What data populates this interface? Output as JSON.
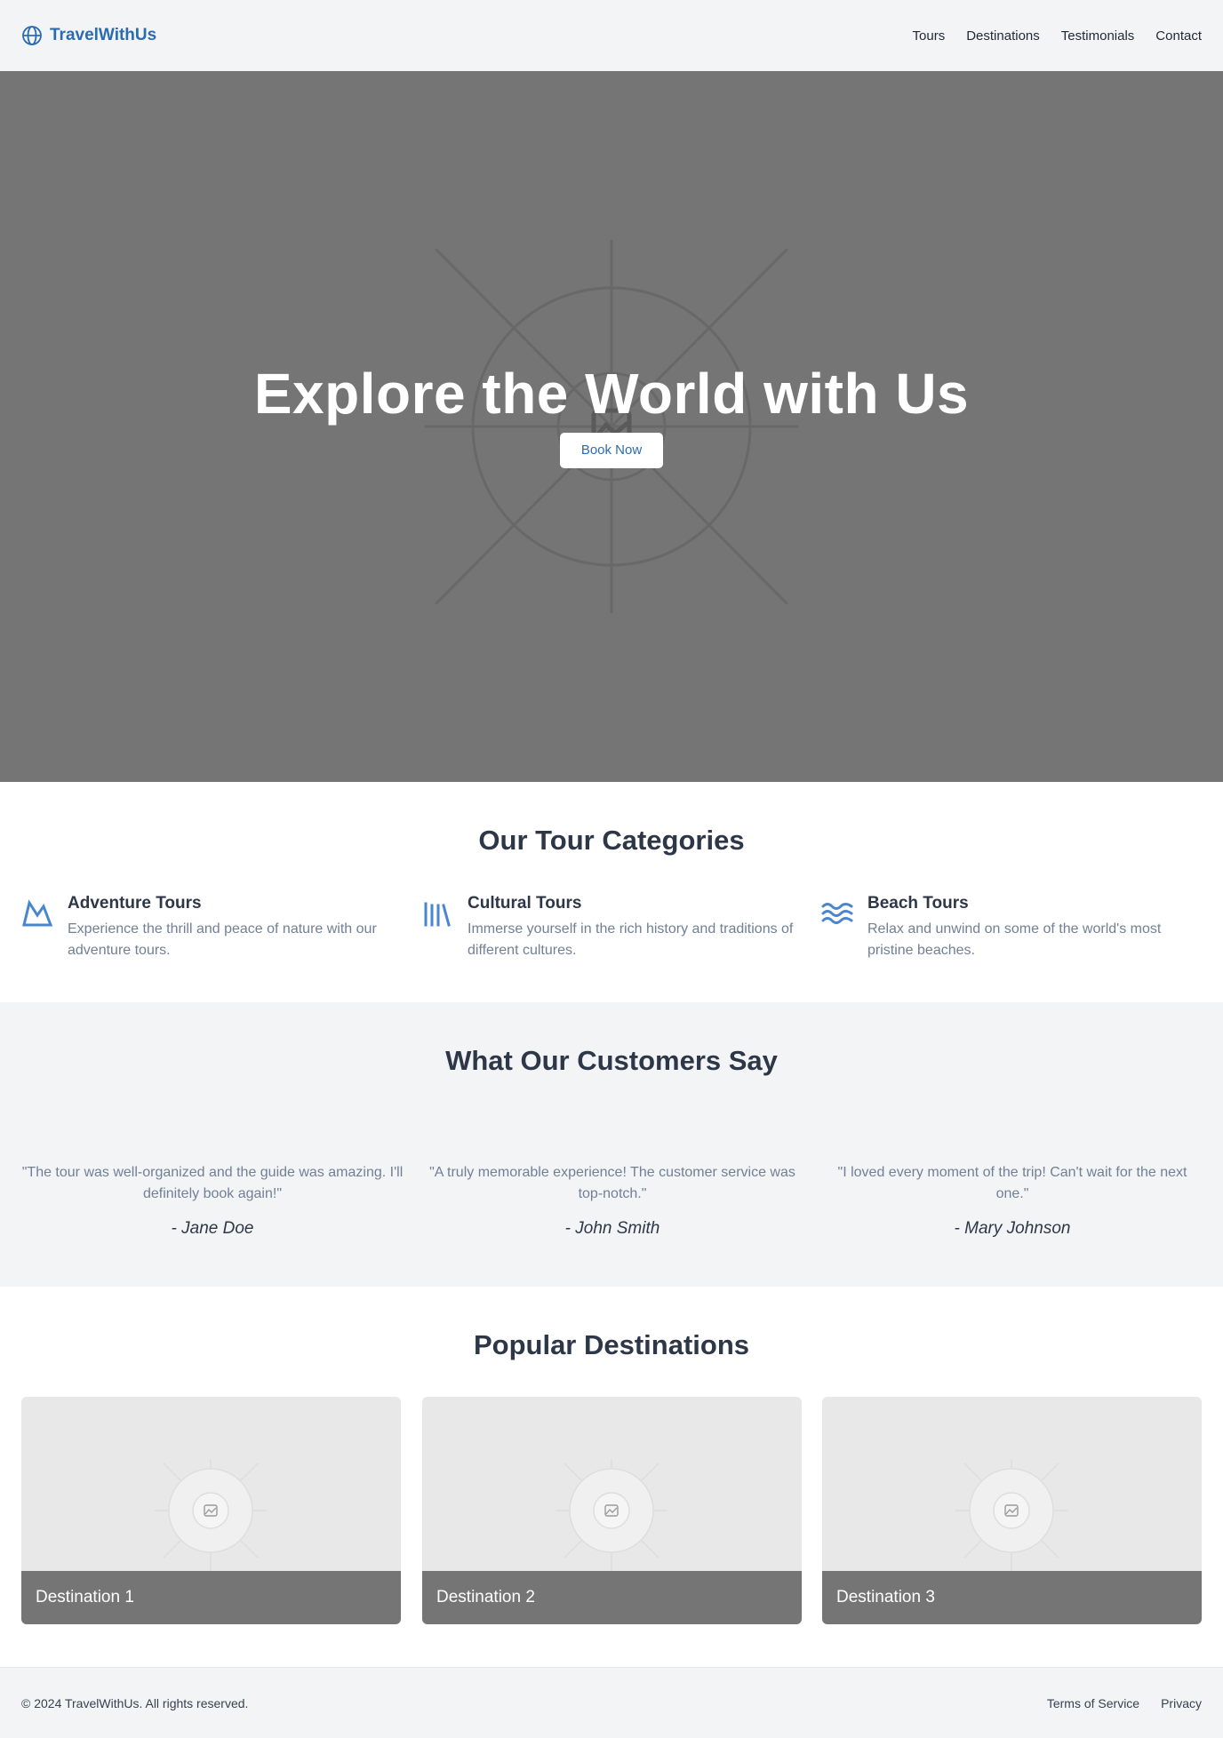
{
  "header": {
    "brand": "TravelWithUs",
    "brand_icon": "globe-icon",
    "nav": [
      "Tours",
      "Destinations",
      "Testimonials",
      "Contact"
    ]
  },
  "hero": {
    "title": "Explore the World with Us",
    "button": "Book Now",
    "image_icon": "image-placeholder-icon"
  },
  "categories": {
    "title": "Our Tour Categories",
    "items": [
      {
        "icon": "mountain-icon",
        "title": "Adventure Tours",
        "desc": "Experience the thrill and peace of nature with our adventure tours."
      },
      {
        "icon": "books-icon",
        "title": "Cultural Tours",
        "desc": "Immerse yourself in the rich history and traditions of different cultures."
      },
      {
        "icon": "waves-icon",
        "title": "Beach Tours",
        "desc": "Relax and unwind on some of the world's most pristine beaches."
      }
    ]
  },
  "testimonials": {
    "title": "What Our Customers Say",
    "items": [
      {
        "quote": "\"The tour was well-organized and the guide was amazing. I'll definitely book again!\"",
        "author": "- Jane Doe"
      },
      {
        "quote": "\"A truly memorable experience! The customer service was top-notch.\"",
        "author": "- John Smith"
      },
      {
        "quote": "\"I loved every moment of the trip! Can't wait for the next one.\"",
        "author": "- Mary Johnson"
      }
    ]
  },
  "destinations": {
    "title": "Popular Destinations",
    "items": [
      {
        "label": "Destination 1"
      },
      {
        "label": "Destination 2"
      },
      {
        "label": "Destination 3"
      }
    ]
  },
  "footer": {
    "copyright": "© 2024 TravelWithUs. All rights reserved.",
    "links": [
      "Terms of Service",
      "Privacy"
    ]
  },
  "colors": {
    "brand": "#2b6cb0",
    "header_bg": "#f3f4f6",
    "hero_bg": "#757575",
    "heading": "#2d3748",
    "muted": "#718096",
    "icon": "#4a86cf"
  }
}
